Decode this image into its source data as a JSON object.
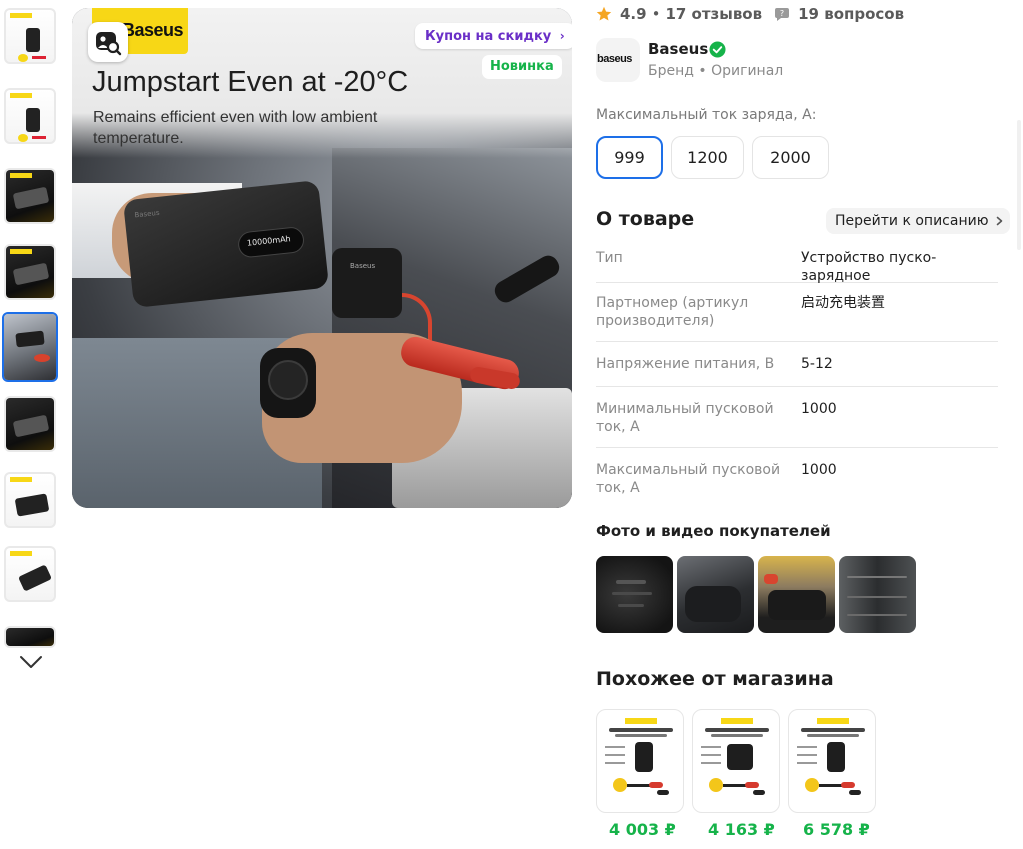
{
  "gallery": {
    "thumb_count": 9,
    "active_index": 4
  },
  "hero": {
    "brand": "Baseus",
    "title": "Jumpstart Even at -20°C",
    "subtitle": "Remains efficient even with low ambient temperature.",
    "coupon_label": "Купон на скидку",
    "new_badge": "Новинка",
    "device_screen": "10000mAh",
    "device_logo": "Baseus",
    "clamp_logo": "Baseus"
  },
  "summary": {
    "rating": "4.9",
    "reviews": "17 отзывов",
    "questions": "19 вопросов"
  },
  "seller": {
    "logo_text": "baseus",
    "name": "Baseus",
    "subtitle": "Бренд • Оригинал"
  },
  "options": {
    "label": "Максимальный ток заряда, А:",
    "values": [
      "999",
      "1200",
      "2000"
    ],
    "selected": "999"
  },
  "about": {
    "title": "О товаре",
    "goto_label": "Перейти к описанию",
    "specs": [
      {
        "key": "Тип",
        "value": "Устройство пуско-зарядное"
      },
      {
        "key": "Партномер (артикул производителя)",
        "value": "启动充电装置"
      },
      {
        "key": "Напряжение питания, В",
        "value": "5-12"
      },
      {
        "key": "Минимальный пусковой ток, А",
        "value": "1000"
      },
      {
        "key": "Максимальный пусковой ток, А",
        "value": "1000"
      }
    ]
  },
  "ugc": {
    "title": "Фото и видео покупателей"
  },
  "similar": {
    "title": "Похожее от магазина",
    "items": [
      {
        "price": "4 003 ₽"
      },
      {
        "price": "4 163 ₽"
      },
      {
        "price": "6 578 ₽"
      }
    ]
  },
  "colors": {
    "accent": "#1d6fe8",
    "price": "#16b34a",
    "coupon": "#6a2fc7",
    "brand_yellow": "#f7d716"
  }
}
